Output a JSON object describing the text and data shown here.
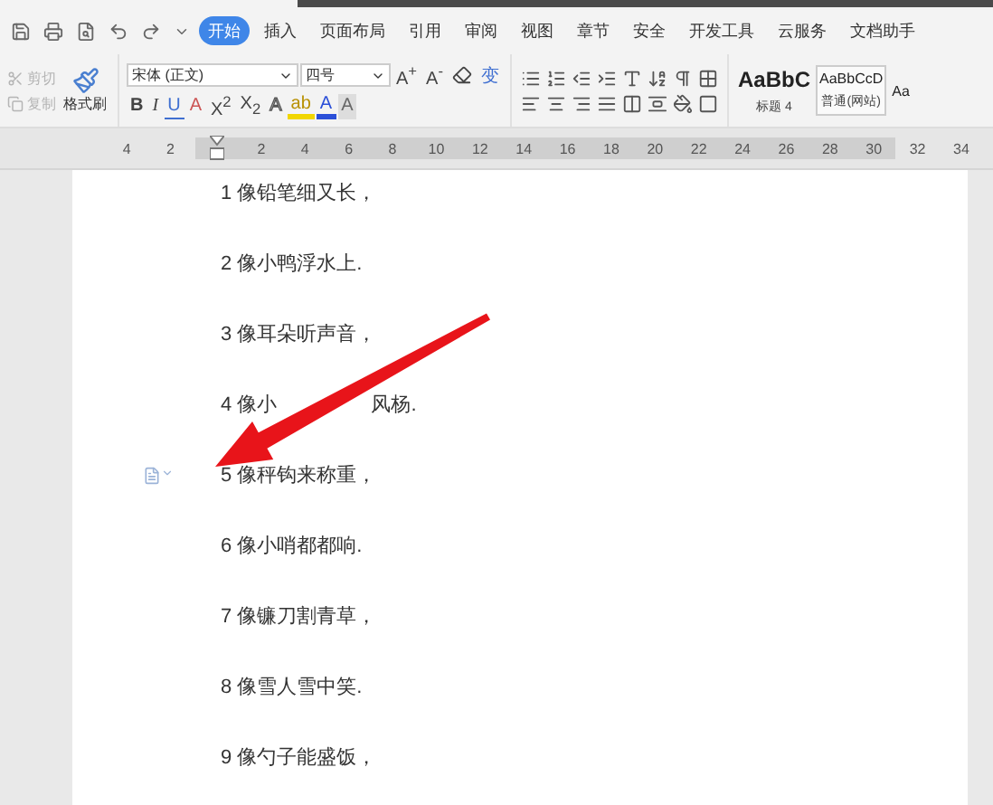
{
  "menu_tabs": [
    {
      "label": "开始",
      "selected": true
    },
    {
      "label": "插入",
      "selected": false
    },
    {
      "label": "页面布局",
      "selected": false
    },
    {
      "label": "引用",
      "selected": false
    },
    {
      "label": "审阅",
      "selected": false
    },
    {
      "label": "视图",
      "selected": false
    },
    {
      "label": "章节",
      "selected": false
    },
    {
      "label": "安全",
      "selected": false
    },
    {
      "label": "开发工具",
      "selected": false
    },
    {
      "label": "云服务",
      "selected": false
    },
    {
      "label": "文档助手",
      "selected": false
    }
  ],
  "clipboard": [
    {
      "label": "剪切",
      "kind": "cut",
      "disabled": true
    },
    {
      "label": "复制",
      "kind": "copy",
      "disabled": true
    }
  ],
  "format_painter": "格式刷",
  "font_name": "宋体 (正文)",
  "font_size": "四号",
  "font_buttons": [
    {
      "label": "A$^{+}$",
      "kind": "plain"
    },
    {
      "label": "A$^{-}$",
      "kind": "plain"
    },
    {
      "kind": "eraser"
    },
    {
      "label": "变",
      "kind": "pinyin"
    }
  ],
  "format_buttons": [
    {
      "label": "B",
      "kind": "bold"
    },
    {
      "label": "I",
      "kind": "italic"
    },
    {
      "label": "U",
      "kind": "underline"
    },
    {
      "label": "A",
      "kind": "strike"
    },
    {
      "label": "X$^{2}$",
      "kind": "plain"
    },
    {
      "label": "X$_{2}$",
      "kind": "plain"
    },
    {
      "label": "A",
      "kind": "outline"
    },
    {
      "label": "ab",
      "kind": "highlight"
    },
    {
      "label": "A",
      "kind": "color"
    },
    {
      "label": "A",
      "kind": "shade"
    }
  ],
  "styles": [
    {
      "preview": "AaBbC",
      "name": "标题 4",
      "kind": "heading",
      "selected": false
    },
    {
      "preview": "AaBbCcD",
      "name": "普通(网站)",
      "kind": "normal",
      "selected": true
    },
    {
      "preview": "Aa",
      "kind": "normal",
      "selected": false
    }
  ],
  "ruler": {
    "left_ticks": [
      "4",
      "2"
    ],
    "ticks": [
      "2",
      "4",
      "6",
      "8",
      "10",
      "12",
      "14",
      "16",
      "18",
      "20",
      "22",
      "24",
      "26",
      "28",
      "30"
    ],
    "right_ticks": [
      "32",
      "34"
    ]
  },
  "lines": [
    {
      "text": "1 像铅笔细又长，",
      "marker": false
    },
    {
      "text": "2 像小鸭浮水上.",
      "marker": false
    },
    {
      "text": "3 像耳朵听声音，",
      "marker": false
    },
    {
      "text": "4 像小",
      "rest": "风杨.",
      "marker": false
    },
    {
      "text": "5 像秤钩来称重，",
      "marker": true
    },
    {
      "text": "6 像小哨都都响.",
      "marker": false
    },
    {
      "text": "7 像镰刀割青草，",
      "marker": false
    },
    {
      "text": "8 像雪人雪中笑.",
      "marker": false
    },
    {
      "text": "9 像勺子能盛饭，",
      "marker": false
    }
  ]
}
